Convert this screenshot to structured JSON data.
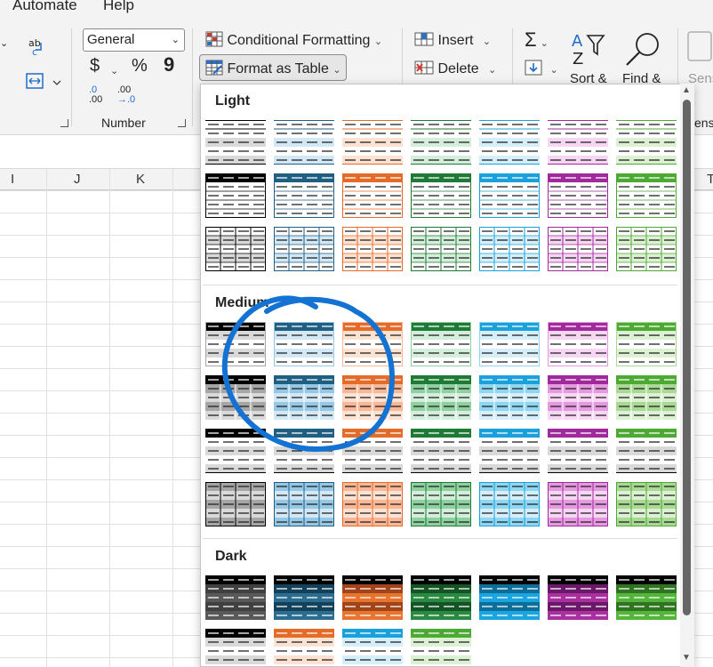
{
  "menu": {
    "items": [
      "Automate",
      "Help"
    ]
  },
  "ribbon": {
    "number_format_value": "General",
    "currency_symbol": "$",
    "percent_symbol": "%",
    "comma_symbol": "9",
    "increase_decimal_top": ".0",
    "increase_decimal_bottom": ".00",
    "decrease_decimal_top": ".00",
    "decrease_decimal_bottom": "→.0",
    "number_group_label": "Number",
    "conditional_formatting_label": "Conditional Formatting",
    "format_as_table_label": "Format as Table",
    "insert_label": "Insert",
    "delete_label": "Delete",
    "sort_label": "Sort &",
    "find_label": "Find &",
    "sensitivity_label": "Sens",
    "sensitivity_group_label": "ens"
  },
  "sheet": {
    "columns": [
      "I",
      "J",
      "K",
      "T"
    ]
  },
  "gallery": {
    "sections": [
      {
        "label": "Light",
        "rows": [
          [
            "light-1",
            "light-2",
            "light-3",
            "light-4",
            "light-5",
            "light-6",
            "light-7"
          ],
          [
            "light-8",
            "light-9",
            "light-10",
            "light-11",
            "light-12",
            "light-13",
            "light-14"
          ],
          [
            "light-15",
            "light-16",
            "light-17",
            "light-18",
            "light-19",
            "light-20",
            "light-21"
          ]
        ]
      },
      {
        "label": "Medium",
        "rows": [
          [
            "medium-1",
            "medium-2",
            "medium-3",
            "medium-4",
            "medium-5",
            "medium-6",
            "medium-7"
          ],
          [
            "medium-8",
            "medium-9",
            "medium-10",
            "medium-11",
            "medium-12",
            "medium-13",
            "medium-14"
          ],
          [
            "medium-15",
            "medium-16",
            "medium-17",
            "medium-18",
            "medium-19",
            "medium-20",
            "medium-21"
          ],
          [
            "medium-22",
            "medium-23",
            "medium-24",
            "medium-25",
            "medium-26",
            "medium-27",
            "medium-28"
          ]
        ]
      },
      {
        "label": "Dark",
        "rows": [
          [
            "dark-1",
            "dark-2",
            "dark-3",
            "dark-4",
            "dark-5",
            "dark-6",
            "dark-7"
          ],
          [
            "dark-8",
            "dark-9",
            "dark-10",
            "dark-11"
          ]
        ]
      }
    ],
    "palette": {
      "black": {
        "dark": "#000000",
        "mid": "#a6a6a6",
        "light": "#d9d9d9",
        "darker": "#404040",
        "deep": "#595959"
      },
      "blue": {
        "dark": "#1f5f82",
        "mid": "#96c8e6",
        "light": "#d2e8f6",
        "darker": "#13415a",
        "deep": "#2b6c8f"
      },
      "orange": {
        "dark": "#e46c28",
        "mid": "#f8b898",
        "light": "#fde2d2",
        "darker": "#a2441a",
        "deep": "#e7742f"
      },
      "green": {
        "dark": "#1e7a35",
        "mid": "#8fd0a0",
        "light": "#d3eedb",
        "darker": "#145424",
        "deep": "#2a8a41"
      },
      "cyan": {
        "dark": "#1aa0da",
        "mid": "#8fd6f2",
        "light": "#d4eff9",
        "darker": "#0d6f99",
        "deep": "#1aa4e0"
      },
      "purple": {
        "dark": "#a02a9c",
        "mid": "#e59ae0",
        "light": "#f7d6f4",
        "darker": "#6b1868",
        "deep": "#a9309f"
      },
      "lime": {
        "dark": "#4caa32",
        "mid": "#a9d994",
        "light": "#dcf0d2",
        "darker": "#2f7420",
        "deep": "#55b53a"
      }
    },
    "color_order": [
      "black",
      "blue",
      "orange",
      "green",
      "cyan",
      "purple",
      "lime"
    ],
    "dark_row2_colors": [
      "black",
      "orange",
      "cyan",
      "lime"
    ],
    "annotation_color": "#1473d2"
  }
}
